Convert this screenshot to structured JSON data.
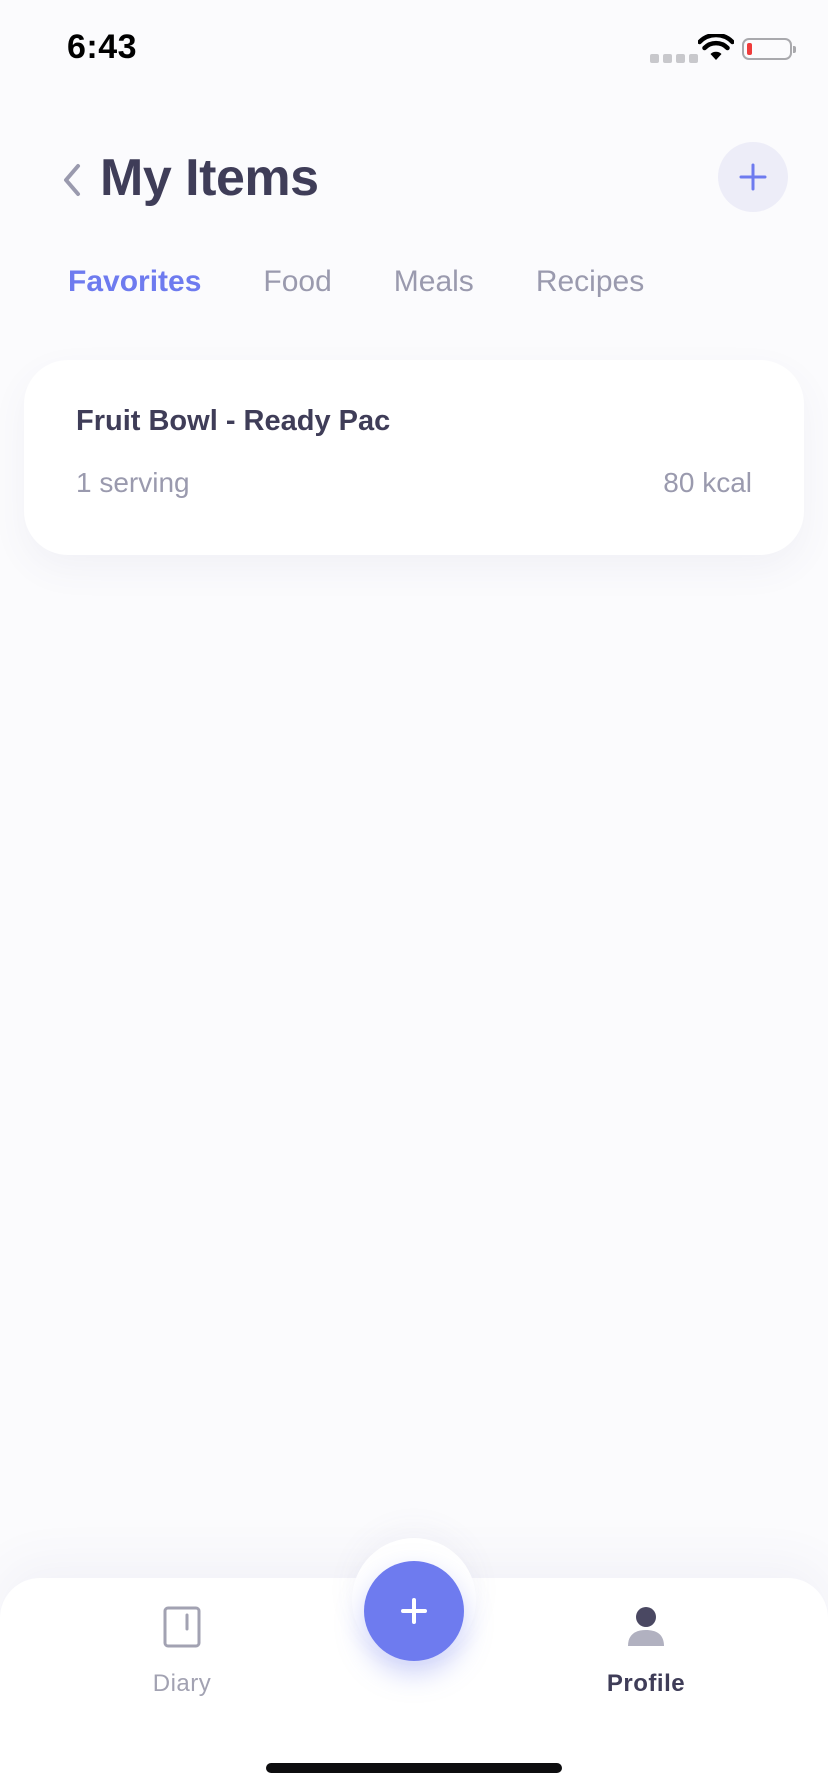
{
  "status_bar": {
    "time": "6:43"
  },
  "header": {
    "title": "My Items"
  },
  "tabs": [
    {
      "label": "Favorites",
      "active": true
    },
    {
      "label": "Food",
      "active": false
    },
    {
      "label": "Meals",
      "active": false
    },
    {
      "label": "Recipes",
      "active": false
    }
  ],
  "items": [
    {
      "name": "Fruit Bowl - Ready Pac",
      "serving": "1 serving",
      "calories": "80 kcal"
    }
  ],
  "bottom_nav": {
    "items": [
      {
        "label": "Diary",
        "icon": "diary-icon",
        "active": false
      },
      {
        "label": "Profile",
        "icon": "profile-icon",
        "active": true
      }
    ],
    "fab_icon": "plus-icon"
  },
  "colors": {
    "accent": "#6e7bef",
    "title": "#3f3d58",
    "muted": "#9a9aae",
    "battery_low": "#ef3b3b"
  }
}
